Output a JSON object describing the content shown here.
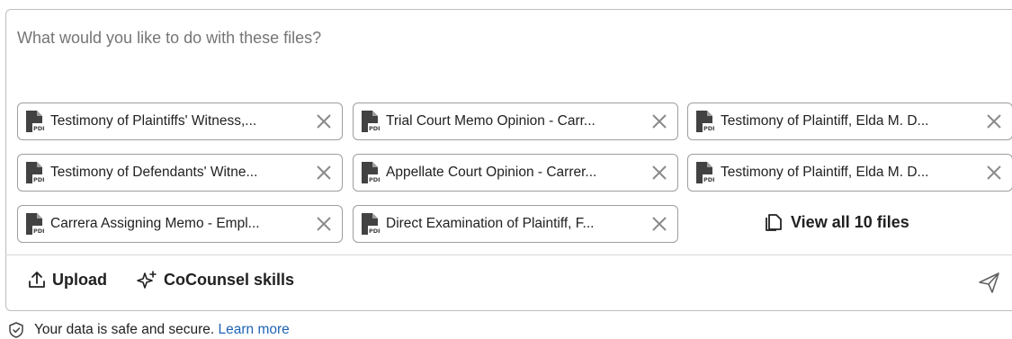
{
  "composer": {
    "placeholder": "What would you like to do with these files?"
  },
  "files": [
    {
      "name": "Testimony of Plaintiffs' Witness,...",
      "icon": "pdf-icon"
    },
    {
      "name": "Trial Court Memo Opinion - Carr...",
      "icon": "pdf-icon"
    },
    {
      "name": "Testimony of Plaintiff, Elda M. D...",
      "icon": "pdf-icon"
    },
    {
      "name": "Testimony of Defendants' Witne...",
      "icon": "pdf-icon"
    },
    {
      "name": "Appellate Court Opinion - Carrer...",
      "icon": "pdf-icon"
    },
    {
      "name": "Testimony of Plaintiff, Elda M. D...",
      "icon": "pdf-icon"
    },
    {
      "name": "Carrera Assigning Memo - Empl...",
      "icon": "pdf-icon"
    },
    {
      "name": "Direct Examination of Plaintiff, F...",
      "icon": "pdf-icon"
    }
  ],
  "view_all_label": "View all 10 files",
  "toolbar": {
    "upload_label": "Upload",
    "skills_label": "CoCounsel skills"
  },
  "footer": {
    "text": "Your data is safe and secure.",
    "link": "Learn more"
  },
  "colors": {
    "link": "#1f63b5",
    "border": "#bdbdbd",
    "chip_border": "#9e9e9e"
  }
}
